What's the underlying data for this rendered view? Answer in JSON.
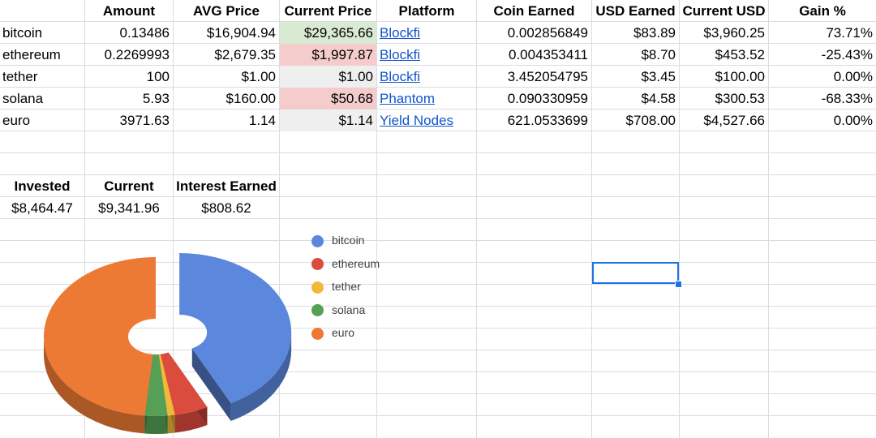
{
  "headers": [
    "",
    "Amount",
    "AVG Price",
    "Current Price",
    "Platform",
    "Coin Earned",
    "USD Earned",
    "Current USD",
    "Gain %"
  ],
  "rows": [
    {
      "name": "bitcoin",
      "amount": "0.13486",
      "avg_price": "$16,904.94",
      "current_price": "$29,365.66",
      "price_fill": "green",
      "platform": "Blockfi",
      "coin_earned": "0.002856849",
      "usd_earned": "$83.89",
      "current_usd": "$3,960.25",
      "gain": "73.71%"
    },
    {
      "name": "ethereum",
      "amount": "0.2269993",
      "avg_price": "$2,679.35",
      "current_price": "$1,997.87",
      "price_fill": "red",
      "platform": "Blockfi",
      "coin_earned": "0.004353411",
      "usd_earned": "$8.70",
      "current_usd": "$453.52",
      "gain": "-25.43%"
    },
    {
      "name": "tether",
      "amount": "100",
      "avg_price": "$1.00",
      "current_price": "$1.00",
      "price_fill": "gray",
      "platform": "Blockfi",
      "coin_earned": "3.452054795",
      "usd_earned": "$3.45",
      "current_usd": "$100.00",
      "gain": "0.00%"
    },
    {
      "name": "solana",
      "amount": "5.93",
      "avg_price": "$160.00",
      "current_price": "$50.68",
      "price_fill": "red",
      "platform": "Phantom",
      "coin_earned": "0.090330959",
      "usd_earned": "$4.58",
      "current_usd": "$300.53",
      "gain": "-68.33%"
    },
    {
      "name": "euro",
      "amount": "3971.63",
      "avg_price": "1.14",
      "current_price": "$1.14",
      "price_fill": "gray",
      "platform": "Yield Nodes",
      "coin_earned": "621.0533699",
      "usd_earned": "$708.00",
      "current_usd": "$4,527.66",
      "gain": "0.00%"
    }
  ],
  "summary": {
    "invested_label": "Invested",
    "invested_value": "$8,464.47",
    "current_label": "Current",
    "current_value": "$9,341.96",
    "interest_label": "Interest Earned",
    "interest_value": "$808.62"
  },
  "colors": {
    "bitcoin": "#5b87dd",
    "ethereum": "#db4b3e",
    "tether": "#f1b83a",
    "solana": "#55a055",
    "euro": "#ed7a34",
    "price_up_fill": "#d9ead3",
    "price_down_fill": "#f4cccc",
    "price_flat_fill": "#efefef",
    "selection": "#1a73e8"
  },
  "chart_data": {
    "type": "pie",
    "style": "3d-donut",
    "categories": [
      "bitcoin",
      "ethereum",
      "tether",
      "solana",
      "euro"
    ],
    "values": [
      3960.25,
      453.52,
      100.0,
      300.53,
      4527.66
    ],
    "colors": [
      "#5b87dd",
      "#db4b3e",
      "#f1b83a",
      "#55a055",
      "#ed7a34"
    ],
    "exploded": [
      "bitcoin"
    ],
    "legend_position": "right"
  }
}
